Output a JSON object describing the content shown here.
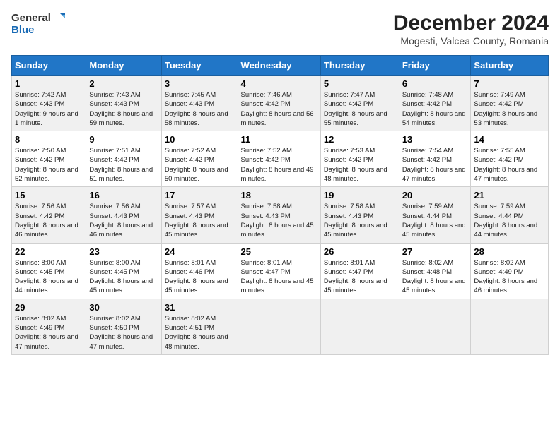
{
  "logo": {
    "line1": "General",
    "line2": "Blue"
  },
  "title": "December 2024",
  "subtitle": "Mogesti, Valcea County, Romania",
  "headers": [
    "Sunday",
    "Monday",
    "Tuesday",
    "Wednesday",
    "Thursday",
    "Friday",
    "Saturday"
  ],
  "weeks": [
    [
      {
        "day": "1",
        "sunrise": "7:42 AM",
        "sunset": "4:43 PM",
        "daylight": "9 hours and 1 minute."
      },
      {
        "day": "2",
        "sunrise": "7:43 AM",
        "sunset": "4:43 PM",
        "daylight": "8 hours and 59 minutes."
      },
      {
        "day": "3",
        "sunrise": "7:45 AM",
        "sunset": "4:43 PM",
        "daylight": "8 hours and 58 minutes."
      },
      {
        "day": "4",
        "sunrise": "7:46 AM",
        "sunset": "4:42 PM",
        "daylight": "8 hours and 56 minutes."
      },
      {
        "day": "5",
        "sunrise": "7:47 AM",
        "sunset": "4:42 PM",
        "daylight": "8 hours and 55 minutes."
      },
      {
        "day": "6",
        "sunrise": "7:48 AM",
        "sunset": "4:42 PM",
        "daylight": "8 hours and 54 minutes."
      },
      {
        "day": "7",
        "sunrise": "7:49 AM",
        "sunset": "4:42 PM",
        "daylight": "8 hours and 53 minutes."
      }
    ],
    [
      {
        "day": "8",
        "sunrise": "7:50 AM",
        "sunset": "4:42 PM",
        "daylight": "8 hours and 52 minutes."
      },
      {
        "day": "9",
        "sunrise": "7:51 AM",
        "sunset": "4:42 PM",
        "daylight": "8 hours and 51 minutes."
      },
      {
        "day": "10",
        "sunrise": "7:52 AM",
        "sunset": "4:42 PM",
        "daylight": "8 hours and 50 minutes."
      },
      {
        "day": "11",
        "sunrise": "7:52 AM",
        "sunset": "4:42 PM",
        "daylight": "8 hours and 49 minutes."
      },
      {
        "day": "12",
        "sunrise": "7:53 AM",
        "sunset": "4:42 PM",
        "daylight": "8 hours and 48 minutes."
      },
      {
        "day": "13",
        "sunrise": "7:54 AM",
        "sunset": "4:42 PM",
        "daylight": "8 hours and 47 minutes."
      },
      {
        "day": "14",
        "sunrise": "7:55 AM",
        "sunset": "4:42 PM",
        "daylight": "8 hours and 47 minutes."
      }
    ],
    [
      {
        "day": "15",
        "sunrise": "7:56 AM",
        "sunset": "4:42 PM",
        "daylight": "8 hours and 46 minutes."
      },
      {
        "day": "16",
        "sunrise": "7:56 AM",
        "sunset": "4:43 PM",
        "daylight": "8 hours and 46 minutes."
      },
      {
        "day": "17",
        "sunrise": "7:57 AM",
        "sunset": "4:43 PM",
        "daylight": "8 hours and 45 minutes."
      },
      {
        "day": "18",
        "sunrise": "7:58 AM",
        "sunset": "4:43 PM",
        "daylight": "8 hours and 45 minutes."
      },
      {
        "day": "19",
        "sunrise": "7:58 AM",
        "sunset": "4:43 PM",
        "daylight": "8 hours and 45 minutes."
      },
      {
        "day": "20",
        "sunrise": "7:59 AM",
        "sunset": "4:44 PM",
        "daylight": "8 hours and 45 minutes."
      },
      {
        "day": "21",
        "sunrise": "7:59 AM",
        "sunset": "4:44 PM",
        "daylight": "8 hours and 44 minutes."
      }
    ],
    [
      {
        "day": "22",
        "sunrise": "8:00 AM",
        "sunset": "4:45 PM",
        "daylight": "8 hours and 44 minutes."
      },
      {
        "day": "23",
        "sunrise": "8:00 AM",
        "sunset": "4:45 PM",
        "daylight": "8 hours and 45 minutes."
      },
      {
        "day": "24",
        "sunrise": "8:01 AM",
        "sunset": "4:46 PM",
        "daylight": "8 hours and 45 minutes."
      },
      {
        "day": "25",
        "sunrise": "8:01 AM",
        "sunset": "4:47 PM",
        "daylight": "8 hours and 45 minutes."
      },
      {
        "day": "26",
        "sunrise": "8:01 AM",
        "sunset": "4:47 PM",
        "daylight": "8 hours and 45 minutes."
      },
      {
        "day": "27",
        "sunrise": "8:02 AM",
        "sunset": "4:48 PM",
        "daylight": "8 hours and 45 minutes."
      },
      {
        "day": "28",
        "sunrise": "8:02 AM",
        "sunset": "4:49 PM",
        "daylight": "8 hours and 46 minutes."
      }
    ],
    [
      {
        "day": "29",
        "sunrise": "8:02 AM",
        "sunset": "4:49 PM",
        "daylight": "8 hours and 47 minutes."
      },
      {
        "day": "30",
        "sunrise": "8:02 AM",
        "sunset": "4:50 PM",
        "daylight": "8 hours and 47 minutes."
      },
      {
        "day": "31",
        "sunrise": "8:02 AM",
        "sunset": "4:51 PM",
        "daylight": "8 hours and 48 minutes."
      },
      null,
      null,
      null,
      null
    ]
  ],
  "labels": {
    "sunrise": "Sunrise:",
    "sunset": "Sunset:",
    "daylight": "Daylight:"
  }
}
